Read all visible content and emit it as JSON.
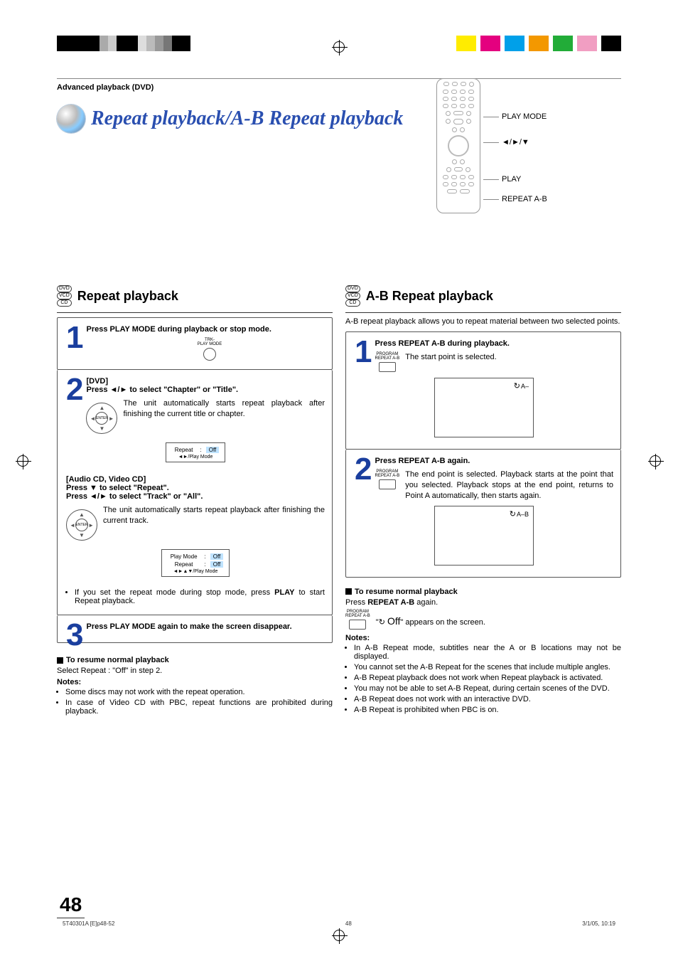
{
  "breadcrumb": "Advanced playback (DVD)",
  "main_title": "Repeat playback/A-B Repeat playback",
  "remote_labels": {
    "play_mode": "PLAY MODE",
    "arrows": "◄/►/▼",
    "play": "PLAY",
    "repeat_ab": "REPEAT A-B"
  },
  "left": {
    "heading": "Repeat playback",
    "disc_types": [
      "DVD",
      "VCD",
      "CD"
    ],
    "step1": {
      "num": "1",
      "head": "Press PLAY MODE during playback or stop mode.",
      "icon_label": "TRK-\nPLAY MODE"
    },
    "step2": {
      "num": "2",
      "dvd_label": "[DVD]",
      "dvd_head": "Press ◄/► to select \"Chapter\" or \"Title\".",
      "dvd_body": "The unit automatically starts repeat playback after finishing the current title or chapter.",
      "enter_label": "ENTER",
      "osd1_row": "Repeat",
      "osd1_val": "Off",
      "osd1_hint": "◄►/Play Mode",
      "cd_label": "[Audio CD, Video CD]",
      "cd_head1": "Press ▼ to select \"Repeat\".",
      "cd_head2": "Press ◄/► to select \"Track\" or \"All\".",
      "cd_body": "The unit automatically starts repeat playback after finishing the current track.",
      "osd2_r1": "Play Mode",
      "osd2_v1": "Off",
      "osd2_r2": "Repeat",
      "osd2_v2": "Off",
      "osd2_hint": "◄►▲▼/Play Mode",
      "tip": "If you set the repeat mode during stop mode, press PLAY to start Repeat playback.",
      "tip_bold": "PLAY"
    },
    "step3": {
      "num": "3",
      "head": "Press PLAY MODE again to make the screen disappear."
    },
    "resume_h": "To resume normal playback",
    "resume_b": "Select Repeat : \"Off\" in step 2.",
    "notes_h": "Notes:",
    "notes": [
      "Some discs may not work with the repeat operation.",
      "In case of Video CD with PBC, repeat functions are prohibited during playback."
    ]
  },
  "right": {
    "heading": "A-B Repeat playback",
    "disc_types": [
      "DVD",
      "VCD",
      "CD"
    ],
    "intro": "A-B repeat playback allows you to repeat material between two selected points.",
    "step1": {
      "num": "1",
      "head": "Press REPEAT A-B during playback.",
      "icon_label": "PROGRAM\nREPEAT A-B",
      "body": "The start point is selected.",
      "screen_mark": "A–"
    },
    "step2": {
      "num": "2",
      "head": "Press REPEAT A-B again.",
      "icon_label": "PROGRAM\nREPEAT A-B",
      "body": "The end point is selected. Playback starts at the point that you selected. Playback stops at the end point, returns to Point A automatically, then starts again.",
      "screen_mark": "A–B"
    },
    "resume_h": "To resume normal playback",
    "resume_b1": "Press ",
    "resume_bold": "REPEAT A-B",
    "resume_b2": " again.",
    "off_text": "Off",
    "off_suffix": "\" appears on the screen.",
    "off_prefix": "\"",
    "notes_h": "Notes:",
    "notes": [
      "In A-B Repeat mode, subtitles near the A or B locations may not be displayed.",
      "You cannot set the A-B Repeat for the scenes that include multiple angles.",
      "A-B Repeat playback does not work when Repeat playback is activated.",
      "You may not be able to set A-B Repeat, during certain scenes of the DVD.",
      "A-B Repeat does not work with an interactive DVD.",
      "A-B Repeat is prohibited when PBC is on."
    ],
    "icon_label_resume": "PROGRAM\nREPEAT A-B"
  },
  "page_number": "48",
  "footer": {
    "file": "5T40301A [E]p48-52",
    "pg": "48",
    "ts": "3/1/05, 10:19"
  }
}
